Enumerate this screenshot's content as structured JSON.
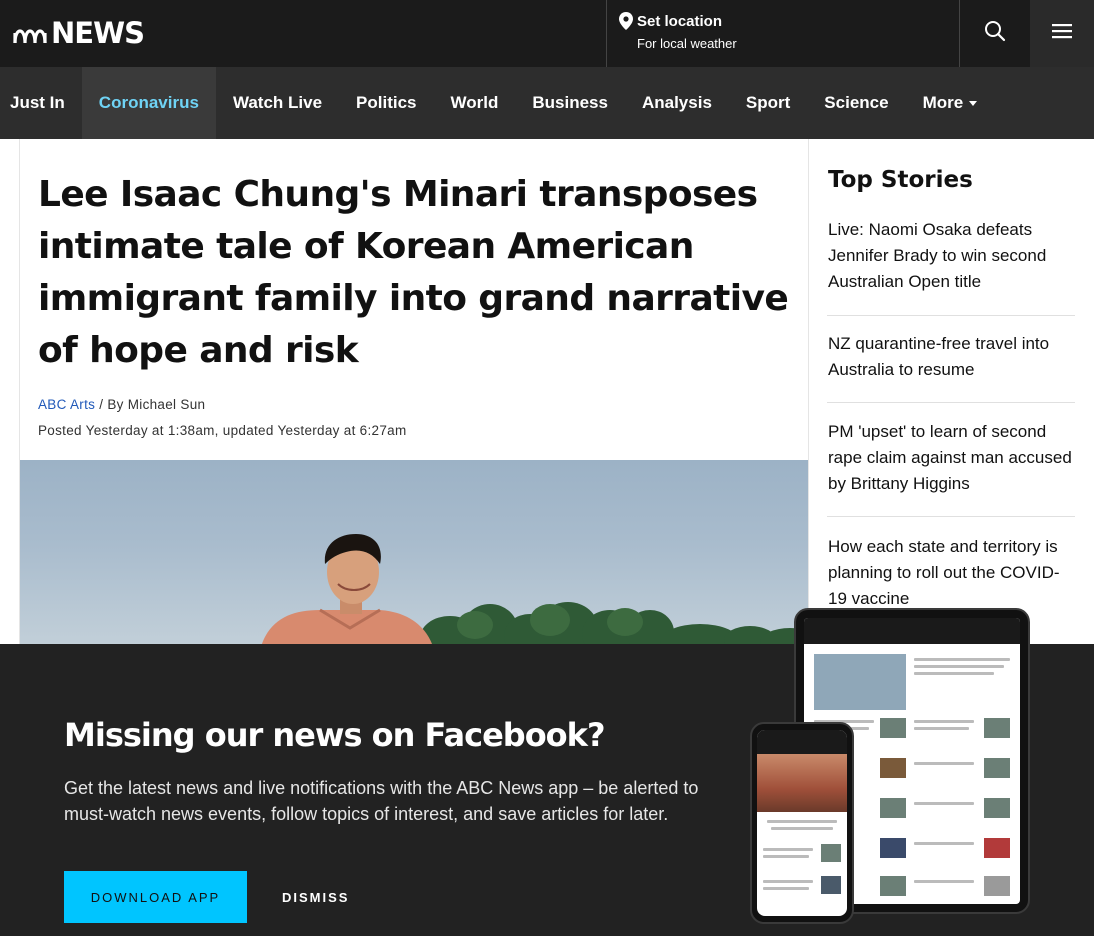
{
  "header": {
    "logo_text": "NEWS",
    "location": {
      "title": "Set location",
      "subtitle": "For local weather"
    }
  },
  "nav": {
    "items": [
      {
        "label": "Just In"
      },
      {
        "label": "Coronavirus",
        "active": true
      },
      {
        "label": "Watch Live"
      },
      {
        "label": "Politics"
      },
      {
        "label": "World"
      },
      {
        "label": "Business"
      },
      {
        "label": "Analysis"
      },
      {
        "label": "Sport"
      },
      {
        "label": "Science"
      },
      {
        "label": "More"
      }
    ]
  },
  "article": {
    "headline": "Lee Isaac Chung's Minari transposes intimate tale of Korean American immigrant family into grand narrative of hope and risk",
    "source": "ABC Arts",
    "byline": " / By Michael Sun",
    "posted": "Posted Yesterday at 1:38am, updated Yesterday at 6:27am"
  },
  "sidebar": {
    "title": "Top Stories",
    "stories": [
      "Live: Naomi Osaka defeats Jennifer Brady to win second Australian Open title",
      "NZ quarantine-free travel into Australia to resume",
      "PM 'upset' to learn of second rape claim against man accused by Brittany Higgins",
      "How each state and territory is planning to roll out the COVID-19 vaccine"
    ]
  },
  "banner": {
    "title": "Missing our news on Facebook?",
    "text": "Get the latest news and live notifications with the ABC News app – be alerted to must-watch news events, follow topics of interest, and save articles for later.",
    "download_label": "DOWNLOAD APP",
    "dismiss_label": "DISMISS"
  },
  "colors": {
    "header_bg": "#1b1b1b",
    "nav_bg": "#2d2d2d",
    "nav_active": "#6fd3f5",
    "link_blue": "#2159b9",
    "banner_bg": "#222222",
    "cta": "#00c5ff"
  },
  "icons": {
    "logo": "abc-logo-icon",
    "location": "location-pin-icon",
    "search": "search-icon",
    "menu": "hamburger-menu-icon",
    "more": "chevron-down-icon"
  }
}
